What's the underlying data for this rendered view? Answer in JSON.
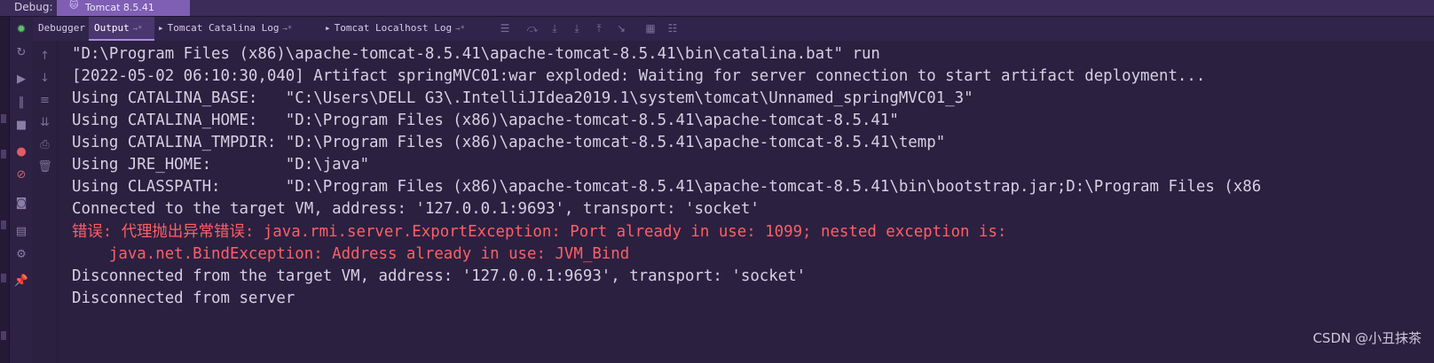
{
  "debug_bar": {
    "label": "Debug:",
    "session_tab": "Tomcat 8.5.41"
  },
  "tabs": [
    {
      "label": "Debugger",
      "pin": ""
    },
    {
      "label": "Output",
      "pin": "→*"
    },
    {
      "label": "Tomcat Catalina Log",
      "pin": "→*"
    },
    {
      "label": "Tomcat Localhost Log",
      "pin": "→*"
    }
  ],
  "console": {
    "lines": [
      "\"D:\\Program Files (x86)\\apache-tomcat-8.5.41\\apache-tomcat-8.5.41\\bin\\catalina.bat\" run",
      "[2022-05-02 06:10:30,040] Artifact springMVC01:war exploded: Waiting for server connection to start artifact deployment...",
      "Using CATALINA_BASE:   \"C:\\Users\\DELL G3\\.IntelliJIdea2019.1\\system\\tomcat\\Unnamed_springMVC01_3\"",
      "Using CATALINA_HOME:   \"D:\\Program Files (x86)\\apache-tomcat-8.5.41\\apache-tomcat-8.5.41\"",
      "Using CATALINA_TMPDIR: \"D:\\Program Files (x86)\\apache-tomcat-8.5.41\\apache-tomcat-8.5.41\\temp\"",
      "Using JRE_HOME:        \"D:\\java\"",
      "Using CLASSPATH:       \"D:\\Program Files (x86)\\apache-tomcat-8.5.41\\apache-tomcat-8.5.41\\bin\\bootstrap.jar;D:\\Program Files (x86",
      "Connected to the target VM, address: '127.0.0.1:9693', transport: 'socket'",
      "错误: 代理抛出异常错误: java.rmi.server.ExportException: Port already in use: 1099; nested exception is:",
      "    java.net.BindException: Address already in use: JVM_Bind",
      "Disconnected from the target VM, address: '127.0.0.1:9693', transport: 'socket'",
      "Disconnected from server"
    ]
  },
  "watermark": "CSDN @小丑抹茶",
  "colors": {
    "background": "#2b2040",
    "error_text": "#ff5f66",
    "normal_text": "#d6d0e2",
    "active_tab": "#4a3770",
    "session_tab": "#7e5fb3"
  },
  "icons": {
    "side_toolbar": [
      "bug-icon",
      "rerun-icon",
      "resume-icon",
      "pause-icon",
      "stop-icon",
      "view-breakpoints-icon",
      "mute-breakpoints-icon",
      "camera-icon",
      "layout-icon",
      "settings-icon",
      "pin-icon"
    ],
    "second_toolbar": [
      "scroll-up-icon",
      "scroll-down-icon",
      "soft-wrap-icon",
      "scroll-to-end-icon",
      "print-icon",
      "clear-all-icon"
    ],
    "tab_tools": [
      "menu-icon",
      "step-over-icon",
      "step-into-icon",
      "force-step-into-icon",
      "step-out-icon",
      "run-to-cursor-icon",
      "evaluate-icon",
      "trace-icon"
    ]
  }
}
